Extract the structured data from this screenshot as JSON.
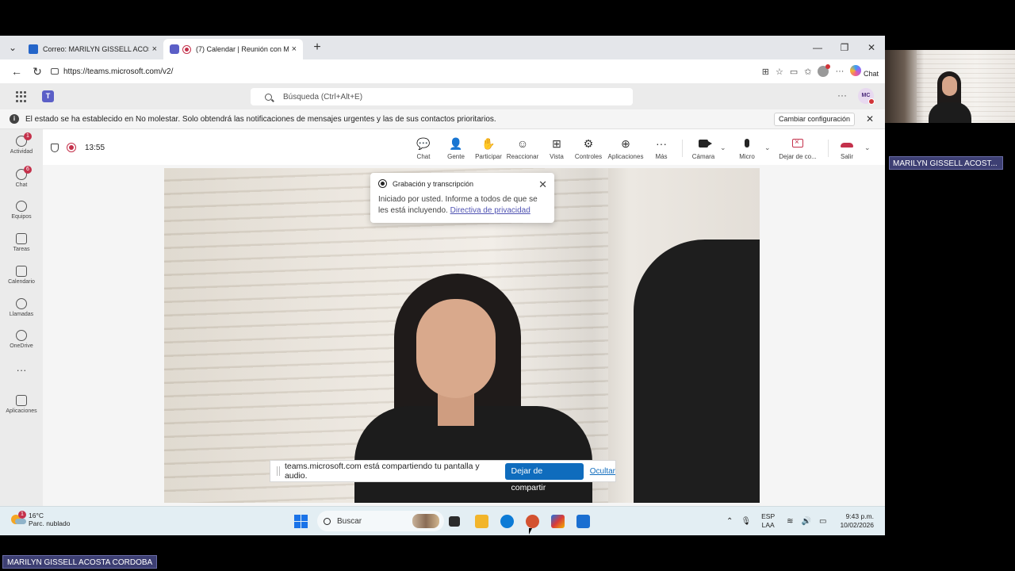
{
  "browser": {
    "tabs": [
      {
        "title": "Correo: MARILYN GISSELL ACOSTA",
        "close": "×",
        "icon": "outlook-mail-icon"
      },
      {
        "title": "(7) Calendar | Reunión con M",
        "close": "×",
        "icon": "teams-icon",
        "recording": true
      }
    ],
    "new_tab": "+",
    "window_controls": {
      "minimize": "—",
      "maximize": "❐",
      "close": "✕"
    },
    "url": "https://teams.microsoft.com/v2/",
    "copilot_label": "Chat"
  },
  "teams_header": {
    "search_placeholder": "Búsqueda (Ctrl+Alt+E)",
    "more": "···",
    "avatar_initials": "MC"
  },
  "banner": {
    "text": "El estado se ha establecido en No molestar. Solo obtendrá las notificaciones de mensajes urgentes y las de sus contactos prioritarios.",
    "button": "Cambiar configuración",
    "info_icon_glyph": "i",
    "close": "✕"
  },
  "left_rail": [
    {
      "label": "Actividad",
      "icon": "bell-icon",
      "badge": "1"
    },
    {
      "label": "Chat",
      "icon": "chat-icon",
      "badge": "6"
    },
    {
      "label": "Equipos",
      "icon": "teams-people-icon",
      "badge": ""
    },
    {
      "label": "Tareas",
      "icon": "tasks-icon",
      "badge": ""
    },
    {
      "label": "Calendario",
      "icon": "calendar-icon",
      "badge": ""
    },
    {
      "label": "Llamadas",
      "icon": "phone-icon",
      "badge": ""
    },
    {
      "label": "OneDrive",
      "icon": "cloud-icon",
      "badge": ""
    },
    {
      "label": "···",
      "icon": "more-icon",
      "badge": ""
    },
    {
      "label": "Aplicaciones",
      "icon": "add-apps-icon",
      "badge": ""
    }
  ],
  "meeting": {
    "timer": "13:55",
    "toolbar": [
      {
        "label": "Chat",
        "glyph": "💬"
      },
      {
        "label": "Gente",
        "glyph": "👤"
      },
      {
        "label": "Participar",
        "glyph": "✋"
      },
      {
        "label": "Reaccionar",
        "glyph": "☺"
      },
      {
        "label": "Vista",
        "glyph": "⊞"
      },
      {
        "label": "Controles",
        "glyph": "⚙"
      },
      {
        "label": "Aplicaciones",
        "glyph": "⊕"
      },
      {
        "label": "Más",
        "glyph": "···"
      }
    ],
    "camera_label": "Cámara",
    "mic_label": "Micro",
    "stop_share_label": "Dejar de co...",
    "leave_label": "Salir",
    "chevron": "⌄"
  },
  "recording_popup": {
    "title": "Grabación y transcripción",
    "body": "Iniciado por usted. Informe a todos de que se les está incluyendo.",
    "link": "Directiva de privacidad",
    "close": "✕"
  },
  "share_bar": {
    "text": "teams.microsoft.com está compartiendo tu pantalla y audio.",
    "stop_button": "Dejar de compartir",
    "hide_link": "Ocultar"
  },
  "taskbar": {
    "weather_temp": "16°C",
    "weather_desc": "Parc. nublado",
    "weather_badge": "1",
    "search": "Buscar",
    "lang_1": "ESP",
    "lang_2": "LAA",
    "time": "9:43 p.m.",
    "date": "10/02/2026",
    "tray_up": "⌃",
    "colors": {
      "edge": "#0c7bd6",
      "files": "#f2b52b",
      "powerpoint": "#d35230",
      "store": "#1a6fd1"
    }
  },
  "participant_label": "MARILYN GISSELL ACOST...",
  "bottom_label": "MARILYN GISSELL ACOSTA CORDOBA"
}
